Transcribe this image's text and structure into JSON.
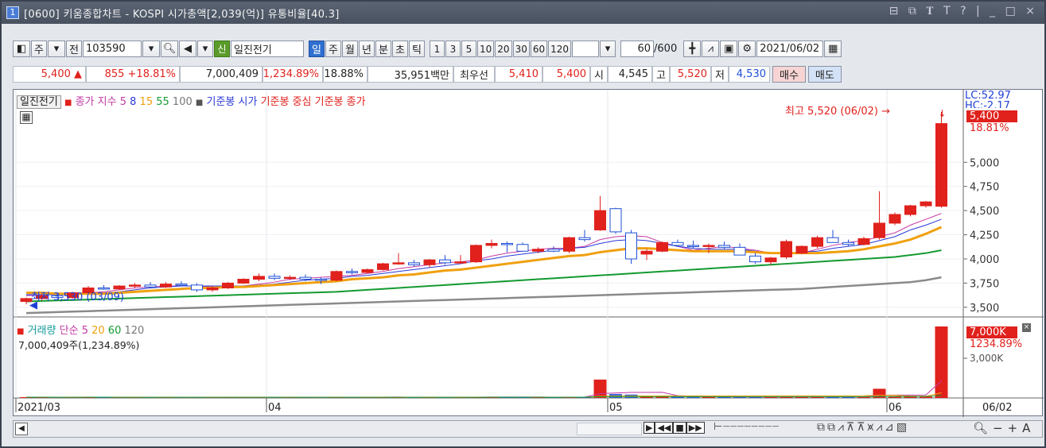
{
  "title": {
    "num": "1",
    "text": "[0600] 키움종합차트 - KOSPI 시가총액[2,039(억)] 유통비율[40.3]",
    "buttons": "⊟ ⧉ 𝚻 T ? | _ □ ×"
  },
  "toolbar1": {
    "type_label": "주",
    "all_label": "전",
    "code": "103590",
    "badge": "신",
    "stock_name": "일진전기",
    "periods": [
      "일",
      "주",
      "월",
      "년",
      "분",
      "초",
      "틱"
    ],
    "active_period": "일",
    "minutes": [
      "1",
      "3",
      "5",
      "10",
      "20",
      "30",
      "60",
      "120"
    ],
    "count": "60",
    "count_max": "/600",
    "date": "2021/06/02"
  },
  "toolbar2": {
    "price": "5,400",
    "change": "855",
    "change_pct": "+18.81%",
    "volume": "7,000,409",
    "vol_pct": "1,234.89%",
    "turnover": "18.88%",
    "amount": "35,951백만",
    "best_label": "최우선",
    "ask": "5,410",
    "bid": "5,400",
    "open_label": "시",
    "open": "4,545",
    "high_label": "고",
    "high": "5,520",
    "low_label": "저",
    "low": "4,530",
    "buy": "매수",
    "sell": "매도"
  },
  "legend_price": {
    "name": "일진전기",
    "ma_label": "종가 지수",
    "ma": [
      "5",
      "8",
      "15",
      "55",
      "100"
    ],
    "ref1": "기준봉 시가",
    "ref2": "기준봉 중심",
    "ref3": "기준봉 종가"
  },
  "legend_volume": {
    "name": "거래량",
    "ma_label": "단순",
    "ma": [
      "5",
      "20",
      "60",
      "120"
    ],
    "text": "7,000,409주(1,234.89%)"
  },
  "annotations": {
    "high": "최고 5,520 (06/02) →",
    "low": "최저 3,530 (03/09)"
  },
  "axis": {
    "lc": "LC:52.97",
    "hc": "HC:-2.17",
    "price_box": "5,400",
    "price_pct": "18.81%",
    "vol_box": "7,000K",
    "vol_pct": "1234.89%",
    "vol_tick": "3,000K",
    "x_last": "06/02"
  },
  "chart_data": {
    "type": "candlestick",
    "ylim": [
      3400,
      5750
    ],
    "yticks": [
      "5,000",
      "4,750",
      "4,500",
      "4,250",
      "4,000",
      "3,750",
      "3,500"
    ],
    "xticks": [
      "2021/03",
      "04",
      "05",
      "06"
    ],
    "series": [
      {
        "name": "일진전기",
        "candles": [
          [
            3560,
            3600,
            3530,
            3590
          ],
          [
            3590,
            3640,
            3570,
            3620
          ],
          [
            3620,
            3640,
            3590,
            3600
          ],
          [
            3600,
            3660,
            3590,
            3650
          ],
          [
            3650,
            3720,
            3640,
            3700
          ],
          [
            3700,
            3730,
            3680,
            3690
          ],
          [
            3690,
            3730,
            3680,
            3720
          ],
          [
            3720,
            3750,
            3700,
            3730
          ],
          [
            3730,
            3760,
            3700,
            3710
          ],
          [
            3710,
            3760,
            3700,
            3740
          ],
          [
            3740,
            3770,
            3720,
            3730
          ],
          [
            3730,
            3750,
            3660,
            3680
          ],
          [
            3680,
            3720,
            3660,
            3700
          ],
          [
            3700,
            3760,
            3690,
            3750
          ],
          [
            3750,
            3800,
            3740,
            3790
          ],
          [
            3790,
            3850,
            3770,
            3820
          ],
          [
            3820,
            3850,
            3780,
            3800
          ],
          [
            3800,
            3830,
            3780,
            3810
          ],
          [
            3810,
            3840,
            3770,
            3790
          ],
          [
            3790,
            3810,
            3740,
            3780
          ],
          [
            3780,
            3880,
            3770,
            3870
          ],
          [
            3870,
            3900,
            3840,
            3860
          ],
          [
            3860,
            3900,
            3850,
            3890
          ],
          [
            3890,
            3960,
            3880,
            3950
          ],
          [
            3950,
            4060,
            3940,
            3960
          ],
          [
            3960,
            3990,
            3920,
            3940
          ],
          [
            3940,
            4000,
            3910,
            3990
          ],
          [
            3990,
            4040,
            3940,
            3960
          ],
          [
            3960,
            4040,
            3950,
            3970
          ],
          [
            3970,
            4150,
            3960,
            4140
          ],
          [
            4140,
            4200,
            4110,
            4160
          ],
          [
            4160,
            4180,
            4070,
            4150
          ],
          [
            4150,
            4170,
            4080,
            4080
          ],
          [
            4080,
            4120,
            4060,
            4100
          ],
          [
            4100,
            4130,
            4070,
            4080
          ],
          [
            4080,
            4230,
            4060,
            4220
          ],
          [
            4220,
            4300,
            4180,
            4200
          ],
          [
            4300,
            4650,
            4290,
            4500
          ],
          [
            4520,
            4530,
            4260,
            4280
          ],
          [
            4270,
            4300,
            3950,
            4000
          ],
          [
            4050,
            4100,
            3990,
            4080
          ],
          [
            4080,
            4180,
            4070,
            4170
          ],
          [
            4170,
            4200,
            4130,
            4140
          ],
          [
            4140,
            4190,
            4110,
            4130
          ],
          [
            4130,
            4160,
            4060,
            4140
          ],
          [
            4140,
            4180,
            4100,
            4120
          ],
          [
            4120,
            4160,
            4040,
            4040
          ],
          [
            4030,
            4060,
            3950,
            3970
          ],
          [
            3970,
            4020,
            3940,
            4010
          ],
          [
            4020,
            4200,
            4000,
            4180
          ],
          [
            4060,
            4140,
            4050,
            4130
          ],
          [
            4130,
            4240,
            4110,
            4220
          ],
          [
            4220,
            4300,
            4180,
            4170
          ],
          [
            4170,
            4200,
            4130,
            4150
          ],
          [
            4150,
            4230,
            4140,
            4210
          ],
          [
            4220,
            4700,
            4200,
            4370
          ],
          [
            4370,
            4480,
            4350,
            4460
          ],
          [
            4460,
            4560,
            4440,
            4550
          ],
          [
            4550,
            4600,
            4530,
            4590
          ],
          [
            4545,
            5520,
            4530,
            5400
          ]
        ]
      },
      {
        "name": "5",
        "values": [
          3620,
          3630,
          3630,
          3640,
          3650,
          3660,
          3680,
          3700,
          3710,
          3720,
          3720,
          3720,
          3710,
          3710,
          3720,
          3740,
          3760,
          3790,
          3800,
          3810,
          3820,
          3830,
          3850,
          3870,
          3900,
          3920,
          3940,
          3960,
          3970,
          3990,
          4030,
          4060,
          4080,
          4100,
          4110,
          4110,
          4130,
          4200,
          4230,
          4240,
          4230,
          4170,
          4130,
          4090,
          4110,
          4130,
          4110,
          4090,
          4060,
          4050,
          4060,
          4100,
          4140,
          4170,
          4190,
          4230,
          4270,
          4350,
          4410,
          4470
        ]
      },
      {
        "name": "8",
        "values": [
          3630,
          3630,
          3630,
          3630,
          3640,
          3650,
          3660,
          3680,
          3700,
          3710,
          3720,
          3720,
          3720,
          3720,
          3720,
          3730,
          3740,
          3760,
          3780,
          3790,
          3800,
          3820,
          3830,
          3850,
          3870,
          3890,
          3910,
          3930,
          3950,
          3980,
          4000,
          4030,
          4050,
          4070,
          4090,
          4110,
          4120,
          4160,
          4190,
          4200,
          4190,
          4160,
          4130,
          4110,
          4100,
          4100,
          4100,
          4080,
          4060,
          4060,
          4070,
          4080,
          4110,
          4130,
          4150,
          4190,
          4230,
          4300,
          4350,
          4410
        ]
      },
      {
        "name": "15",
        "values": [
          3650,
          3650,
          3640,
          3640,
          3640,
          3640,
          3650,
          3660,
          3670,
          3680,
          3690,
          3700,
          3700,
          3710,
          3710,
          3720,
          3730,
          3740,
          3750,
          3760,
          3770,
          3790,
          3800,
          3810,
          3830,
          3840,
          3860,
          3880,
          3890,
          3910,
          3930,
          3950,
          3970,
          3990,
          4010,
          4030,
          4040,
          4070,
          4090,
          4110,
          4110,
          4100,
          4090,
          4080,
          4080,
          4080,
          4080,
          4070,
          4060,
          4060,
          4060,
          4060,
          4070,
          4080,
          4100,
          4130,
          4160,
          4200,
          4260,
          4330
        ]
      },
      {
        "name": "55",
        "values": [
          3560,
          3565,
          3570,
          3575,
          3580,
          3585,
          3590,
          3595,
          3600,
          3605,
          3610,
          3615,
          3620,
          3625,
          3630,
          3635,
          3640,
          3645,
          3650,
          3655,
          3660,
          3670,
          3680,
          3690,
          3700,
          3710,
          3720,
          3730,
          3740,
          3750,
          3760,
          3770,
          3780,
          3790,
          3800,
          3810,
          3820,
          3830,
          3840,
          3850,
          3860,
          3870,
          3880,
          3890,
          3900,
          3910,
          3920,
          3930,
          3940,
          3950,
          3960,
          3970,
          3980,
          3990,
          4000,
          4010,
          4020,
          4040,
          4060,
          4090
        ]
      },
      {
        "name": "100",
        "values": [
          3440,
          3445,
          3450,
          3455,
          3460,
          3465,
          3470,
          3475,
          3480,
          3485,
          3490,
          3495,
          3500,
          3505,
          3510,
          3515,
          3520,
          3525,
          3530,
          3535,
          3540,
          3545,
          3550,
          3555,
          3560,
          3565,
          3570,
          3575,
          3580,
          3585,
          3590,
          3595,
          3600,
          3605,
          3610,
          3615,
          3620,
          3625,
          3630,
          3635,
          3640,
          3645,
          3650,
          3655,
          3660,
          3665,
          3670,
          3675,
          3680,
          3685,
          3690,
          3700,
          3710,
          3720,
          3730,
          3740,
          3750,
          3760,
          3780,
          3810
        ]
      },
      {
        "name": "거래량",
        "values": [
          80,
          70,
          60,
          80,
          90,
          70,
          60,
          70,
          60,
          70,
          60,
          60,
          60,
          70,
          80,
          70,
          60,
          60,
          60,
          60,
          90,
          70,
          70,
          80,
          110,
          70,
          80,
          70,
          70,
          110,
          110,
          80,
          70,
          60,
          60,
          90,
          110,
          1800,
          380,
          330,
          120,
          150,
          120,
          110,
          110,
          110,
          100,
          100,
          90,
          130,
          100,
          120,
          130,
          90,
          100,
          900,
          180,
          160,
          140,
          7000
        ]
      }
    ]
  }
}
